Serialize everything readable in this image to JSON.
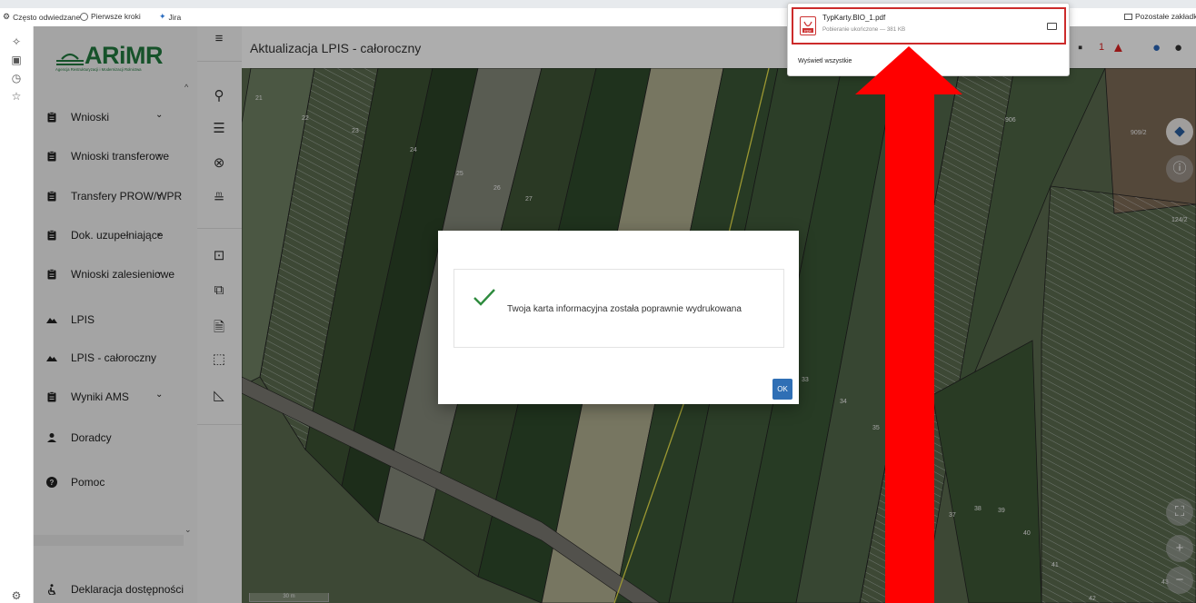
{
  "browser": {
    "bookmarks": [
      {
        "label": "Często odwiedzane",
        "icon": "gear-icon"
      },
      {
        "label": "Pierwsze kroki",
        "icon": "globe-icon"
      },
      {
        "label": "Jira",
        "icon": "jira-icon"
      }
    ],
    "other_bookmarks": "Pozostałe zakładki"
  },
  "app": {
    "logo_text": "ARiMR",
    "logo_subtitle": "Agencja Restrukturyzacji i Modernizacji Rolnictwa",
    "page_title": "Aktualizacja LPIS - całoroczny",
    "notification_count": "1"
  },
  "sidebar": {
    "items": [
      {
        "label": "Wnioski",
        "icon": "clipboard-icon",
        "has_chevron": true
      },
      {
        "label": "Wnioski transferowe",
        "icon": "clipboard-icon",
        "has_chevron": true
      },
      {
        "label": "Transfery PROW/WPR",
        "icon": "clipboard-icon",
        "has_chevron": true
      },
      {
        "label": "Dok. uzupełniające",
        "icon": "clipboard-icon",
        "has_chevron": true
      },
      {
        "label": "Wnioski zalesieniowe",
        "icon": "clipboard-icon",
        "has_chevron": true
      },
      {
        "label": "LPIS",
        "icon": "terrain-icon",
        "has_chevron": false
      },
      {
        "label": "LPIS - całoroczny",
        "icon": "terrain-icon",
        "has_chevron": false
      },
      {
        "label": "Wyniki AMS",
        "icon": "clipboard-icon",
        "has_chevron": true
      },
      {
        "label": "Doradcy",
        "icon": "person-icon",
        "has_chevron": false
      },
      {
        "label": "Pomoc",
        "icon": "help-icon",
        "has_chevron": false
      }
    ],
    "accessibility": "Deklaracja dostępności"
  },
  "map": {
    "parcel_labels": [
      "21",
      "22",
      "23",
      "24",
      "25",
      "26",
      "27",
      "906",
      "909/2",
      "124/2",
      "33",
      "34",
      "35",
      "37",
      "38",
      "39",
      "40",
      "41",
      "42",
      "43"
    ],
    "scale_label": "30 m"
  },
  "dialog": {
    "message": "Twoja karta informacyjna została poprawnie wydrukowana",
    "ok_label": "OK"
  },
  "download": {
    "filename": "TypKarty.BIO_1.pdf",
    "status": "Pobieranie ukończone — 381 KB",
    "show_all": "Wyświetl wszystkie"
  },
  "colors": {
    "brand_green": "#217a3f",
    "ok_blue": "#2f6fb5",
    "highlight_red": "#ff0000"
  }
}
